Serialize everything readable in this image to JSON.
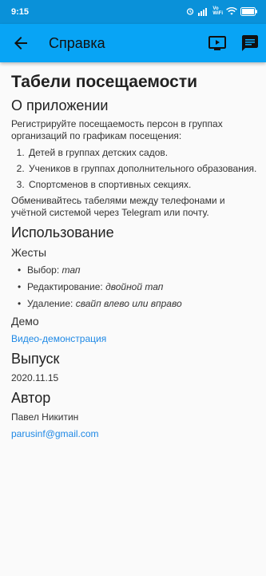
{
  "status_bar": {
    "time": "9:15",
    "icons": [
      "alarm-icon",
      "signal-icon",
      "volte-icon",
      "wifi-icon",
      "battery-icon"
    ],
    "network_label": "Vo\nWiFi"
  },
  "app_bar": {
    "title": "Справка",
    "background": "#08a4f5",
    "back_icon": "arrow-left-icon",
    "action_icons": [
      "video-play-icon",
      "feedback-message-icon"
    ]
  },
  "content": {
    "page_title": "Табели посещаемости",
    "about": {
      "heading": "О приложении",
      "intro": "Регистрируйте посещаемость персон в группах организаций по графикам посещения:",
      "items": [
        "Детей в группах детских садов.",
        "Учеников в группах дополнительного образования.",
        "Спортсменов в спортивных секциях."
      ],
      "outro": "Обменивайтесь табелями между телефонами и учётной системой через Telegram или почту."
    },
    "usage": {
      "heading": "Использование",
      "gestures_label": "Жесты",
      "gestures": [
        {
          "label": "Выбор: ",
          "value": "тап"
        },
        {
          "label": "Редактирование: ",
          "value": "двойной тап"
        },
        {
          "label": "Удаление: ",
          "value": "свайп влево или вправо"
        }
      ],
      "demo_label": "Демо",
      "demo_link": "Видео-демонстрация"
    },
    "release": {
      "heading": "Выпуск",
      "date": "2020.11.15"
    },
    "author": {
      "heading": "Автор",
      "name": "Павел Никитин",
      "email": "parusinf@gmail.com"
    }
  },
  "link_color": "#1e88e5"
}
